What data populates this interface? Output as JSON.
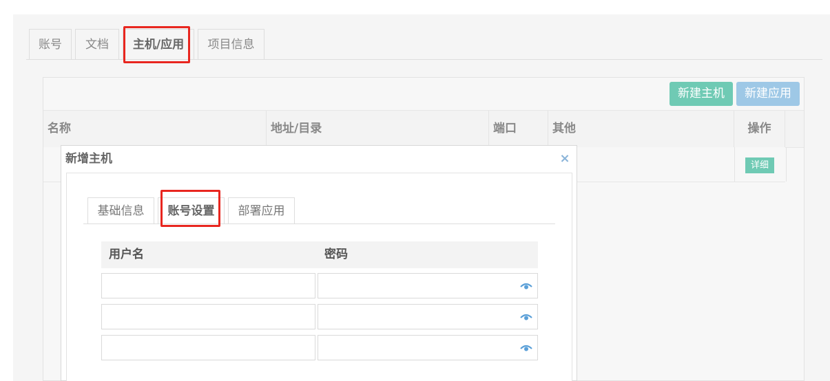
{
  "top_tabs": [
    {
      "label": "账号"
    },
    {
      "label": "文档"
    },
    {
      "label": "主机/应用"
    },
    {
      "label": "项目信息"
    }
  ],
  "toolbar": {
    "new_host": "新建主机",
    "new_app": "新建应用"
  },
  "table": {
    "columns": [
      "名称",
      "地址/目录",
      "端口",
      "其他",
      "操作"
    ],
    "rows": [
      {
        "action": "详细"
      }
    ]
  },
  "modal": {
    "title": "新增主机",
    "close": "×",
    "tabs": [
      {
        "label": "基础信息"
      },
      {
        "label": "账号设置"
      },
      {
        "label": "部署应用"
      }
    ],
    "accounts": {
      "headers": {
        "username": "用户名",
        "password": "密码"
      },
      "rows": [
        {
          "username": "",
          "password": ""
        },
        {
          "username": "",
          "password": ""
        },
        {
          "username": "",
          "password": ""
        }
      ]
    }
  },
  "colors": {
    "highlight": "#e8261f",
    "new_host_button": "#6fcab4",
    "new_app_button": "#9ec8e6",
    "eye_icon": "#5ba0d8"
  },
  "icons": [
    "close-icon",
    "eye-icon"
  ]
}
